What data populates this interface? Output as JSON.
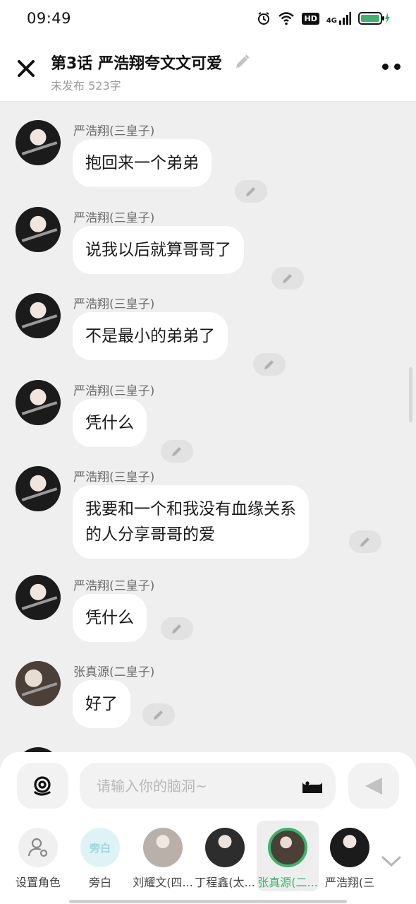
{
  "status_bar": {
    "time": "09:49",
    "network": "4G",
    "hd": "HD"
  },
  "header": {
    "title": "第3话   严浩翔夸文文可爱",
    "subtitle": "未发布 523字"
  },
  "messages": [
    {
      "sender": "严浩翔(三皇子)",
      "text": "抱回来一个弟弟"
    },
    {
      "sender": "严浩翔(三皇子)",
      "text": "说我以后就算哥哥了"
    },
    {
      "sender": "严浩翔(三皇子)",
      "text": "不是最小的弟弟了"
    },
    {
      "sender": "严浩翔(三皇子)",
      "text": "凭什么"
    },
    {
      "sender": "严浩翔(三皇子)",
      "line1": "我要和一个和我没有血缘关系",
      "line2": "的人分享哥哥的爱"
    },
    {
      "sender": "严浩翔(三皇子)",
      "text": "凭什么"
    },
    {
      "sender": "张真源(二皇子)",
      "text": "好了"
    }
  ],
  "input": {
    "placeholder": "请输入你的脑洞~"
  },
  "roles": [
    {
      "label": "设置角色"
    },
    {
      "label": "旁白",
      "avatar_text": "旁白"
    },
    {
      "label": "刘耀文(四..."
    },
    {
      "label": "丁程鑫(太..."
    },
    {
      "label": "张真源(二...",
      "selected": true
    },
    {
      "label": "严浩翔(三"
    }
  ],
  "colors": {
    "accent": "#3db36b",
    "background": "#efefef",
    "bubble": "#ffffff"
  }
}
